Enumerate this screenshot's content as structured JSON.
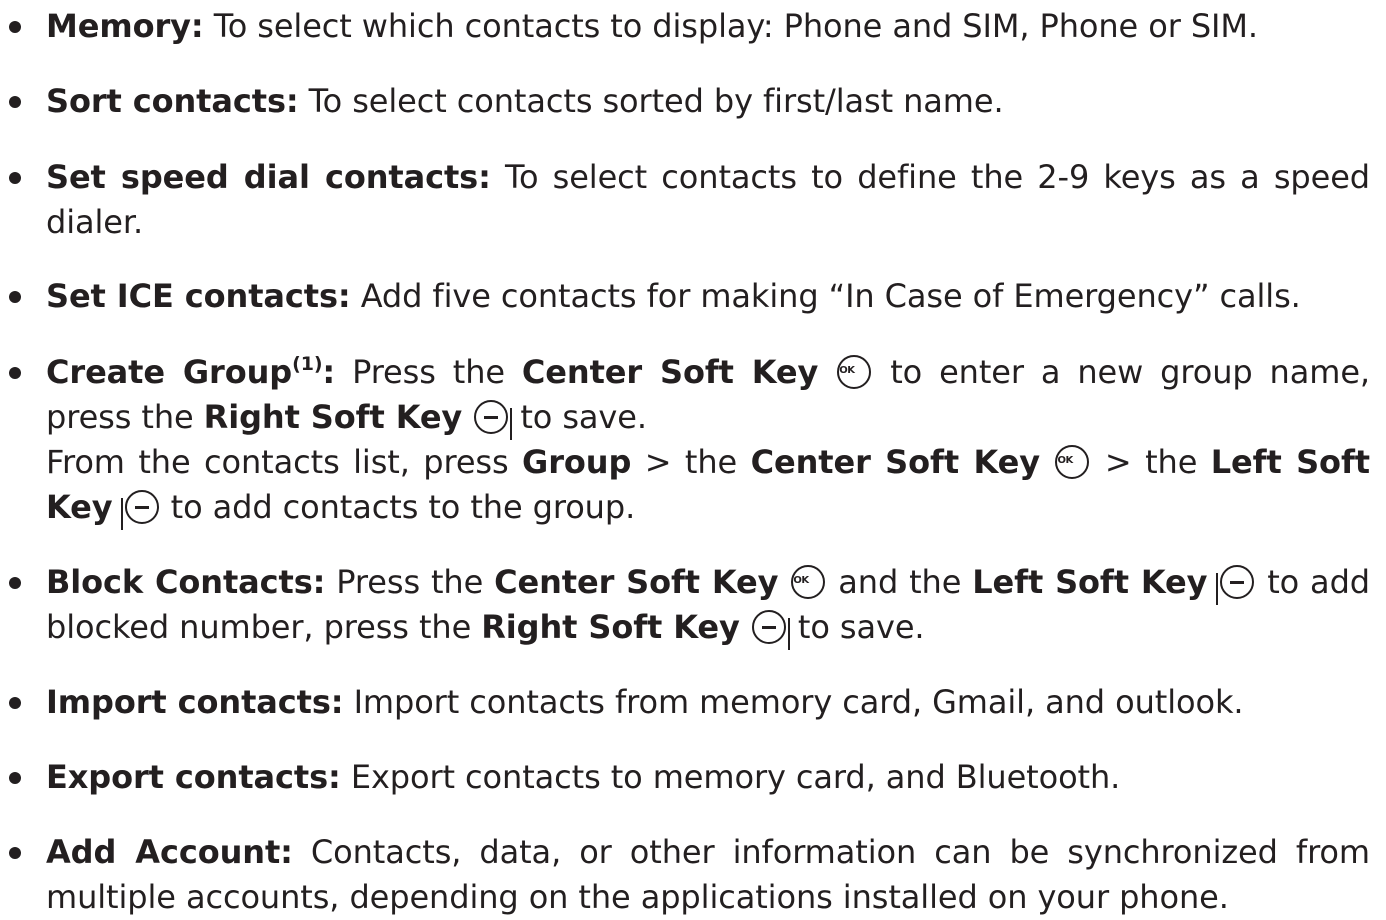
{
  "items": [
    {
      "label": "Memory:",
      "text": " To select which contacts to display: Phone and SIM, Phone or SIM."
    },
    {
      "label": "Sort contacts:",
      "text": " To select contacts sorted by first/last name."
    },
    {
      "label": "Set speed dial contacts:",
      "text": " To select contacts to define the 2-9 keys as a speed dialer."
    },
    {
      "label": "Set ICE contacts:",
      "text": " Add five contacts for making “In Case of Emergency” calls."
    },
    {
      "label": "Create Group",
      "sup": "(1)",
      "colon": ":",
      "p1": " Press the ",
      "center_key": "Center Soft Key",
      "p2": " to enter a new group name, press the ",
      "right_key": "Right Soft Key",
      "p3": " to save.",
      "p4": "From the contacts list, press ",
      "group": "Group",
      "p5": " > the ",
      "center_key2": "Center Soft Key",
      "p6": " > the ",
      "left_key": "Left Soft Key",
      "p7": " to add contacts to the group."
    },
    {
      "label": "Block Contacts:",
      "p1": " Press the ",
      "center_key": "Center Soft Key",
      "p2": " and the ",
      "left_key": "Left Soft Key",
      "p3": " to add blocked number, press the ",
      "right_key": "Right Soft Key",
      "p4": " to save."
    },
    {
      "label": "Import contacts:",
      "text": " Import contacts from memory card, Gmail, and outlook."
    },
    {
      "label": "Export contacts:",
      "text": " Export contacts to memory card, and Bluetooth."
    },
    {
      "label": "Add Account:",
      "text": " Contacts, data, or other information can be synchronized from multiple accounts, depending on the applications installed on your phone."
    }
  ],
  "icons": {
    "center_soft_key": "ok-circle-icon",
    "right_soft_key": "right-soft-key-icon",
    "left_soft_key": "left-soft-key-icon"
  }
}
